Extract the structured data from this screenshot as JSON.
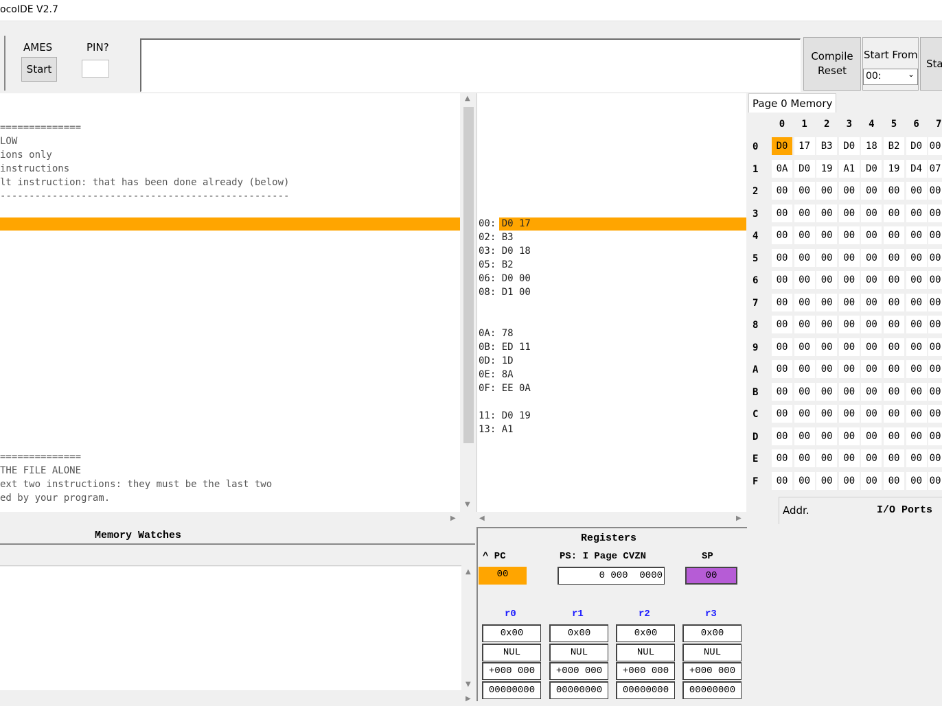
{
  "window": {
    "title": "ocoIDE V2.7"
  },
  "toolbar": {
    "games_label": "AMES",
    "start_label": "Start",
    "pin_label": "PIN?",
    "pin_value": "",
    "compile_label": "Compile",
    "reset_label": "Reset",
    "start_from_label": "Start From",
    "start_from_value": "00:",
    "start2_label": "Sta"
  },
  "source": {
    "lines": [
      "==============",
      "LOW",
      "ions only",
      "instructions",
      "lt instruction: that has been done already (below)",
      "--------------------------------------------------",
      "",
      "",
      "",
      "",
      "",
      "",
      "",
      "",
      "",
      "",
      "",
      "",
      "",
      "",
      "",
      "",
      "",
      "",
      "==============",
      "THE FILE ALONE",
      "ext two instructions: they must be the last two",
      "ed by your program."
    ]
  },
  "assembly": {
    "lines": [
      "00: D0 17",
      "02: B3",
      "03: D0 18",
      "05: B2",
      "06: D0 00",
      "08: D1 00",
      "",
      "",
      "0A: 78",
      "0B: ED 11",
      "0D: 1D",
      "0E: 8A",
      "0F: EE 0A",
      "",
      "11: D0 19",
      "13: A1"
    ]
  },
  "memory": {
    "title": "Page 0 Memory",
    "col_headers": [
      "0",
      "1",
      "2",
      "3",
      "4",
      "5",
      "6",
      "7"
    ],
    "row_headers": [
      "0",
      "1",
      "2",
      "3",
      "4",
      "5",
      "6",
      "7",
      "8",
      "9",
      "A",
      "B",
      "C",
      "D",
      "E",
      "F"
    ],
    "rows": [
      [
        "D0",
        "17",
        "B3",
        "D0",
        "18",
        "B2",
        "D0",
        "00"
      ],
      [
        "0A",
        "D0",
        "19",
        "A1",
        "D0",
        "19",
        "D4",
        "07"
      ],
      [
        "00",
        "00",
        "00",
        "00",
        "00",
        "00",
        "00",
        "00"
      ],
      [
        "00",
        "00",
        "00",
        "00",
        "00",
        "00",
        "00",
        "00"
      ],
      [
        "00",
        "00",
        "00",
        "00",
        "00",
        "00",
        "00",
        "00"
      ],
      [
        "00",
        "00",
        "00",
        "00",
        "00",
        "00",
        "00",
        "00"
      ],
      [
        "00",
        "00",
        "00",
        "00",
        "00",
        "00",
        "00",
        "00"
      ],
      [
        "00",
        "00",
        "00",
        "00",
        "00",
        "00",
        "00",
        "00"
      ],
      [
        "00",
        "00",
        "00",
        "00",
        "00",
        "00",
        "00",
        "00"
      ],
      [
        "00",
        "00",
        "00",
        "00",
        "00",
        "00",
        "00",
        "00"
      ],
      [
        "00",
        "00",
        "00",
        "00",
        "00",
        "00",
        "00",
        "00"
      ],
      [
        "00",
        "00",
        "00",
        "00",
        "00",
        "00",
        "00",
        "00"
      ],
      [
        "00",
        "00",
        "00",
        "00",
        "00",
        "00",
        "00",
        "00"
      ],
      [
        "00",
        "00",
        "00",
        "00",
        "00",
        "00",
        "00",
        "00"
      ],
      [
        "00",
        "00",
        "00",
        "00",
        "00",
        "00",
        "00",
        "00"
      ],
      [
        "00",
        "00",
        "00",
        "00",
        "00",
        "00",
        "00",
        "00"
      ]
    ],
    "highlight_color": "#ffa500"
  },
  "watches": {
    "title": "Memory Watches"
  },
  "ports": {
    "addr_label": "Addr.",
    "io_label": "I/O Ports"
  },
  "registers": {
    "title": "Registers",
    "pc_label": "^ PC",
    "pc_value": "00",
    "ps_label": "PS: I Page CVZN",
    "ps_value": "0 000  0000",
    "sp_label": "SP",
    "sp_value": "00",
    "pc_color": "#ffa500",
    "sp_color": "#b65cd6",
    "general": [
      {
        "name": "r0",
        "hex": "0x00",
        "char": "NUL",
        "dec": "+000 000",
        "bin": "00000000"
      },
      {
        "name": "r1",
        "hex": "0x00",
        "char": "NUL",
        "dec": "+000 000",
        "bin": "00000000"
      },
      {
        "name": "r2",
        "hex": "0x00",
        "char": "NUL",
        "dec": "+000 000",
        "bin": "00000000"
      },
      {
        "name": "r3",
        "hex": "0x00",
        "char": "NUL",
        "dec": "+000 000",
        "bin": "00000000"
      }
    ]
  }
}
